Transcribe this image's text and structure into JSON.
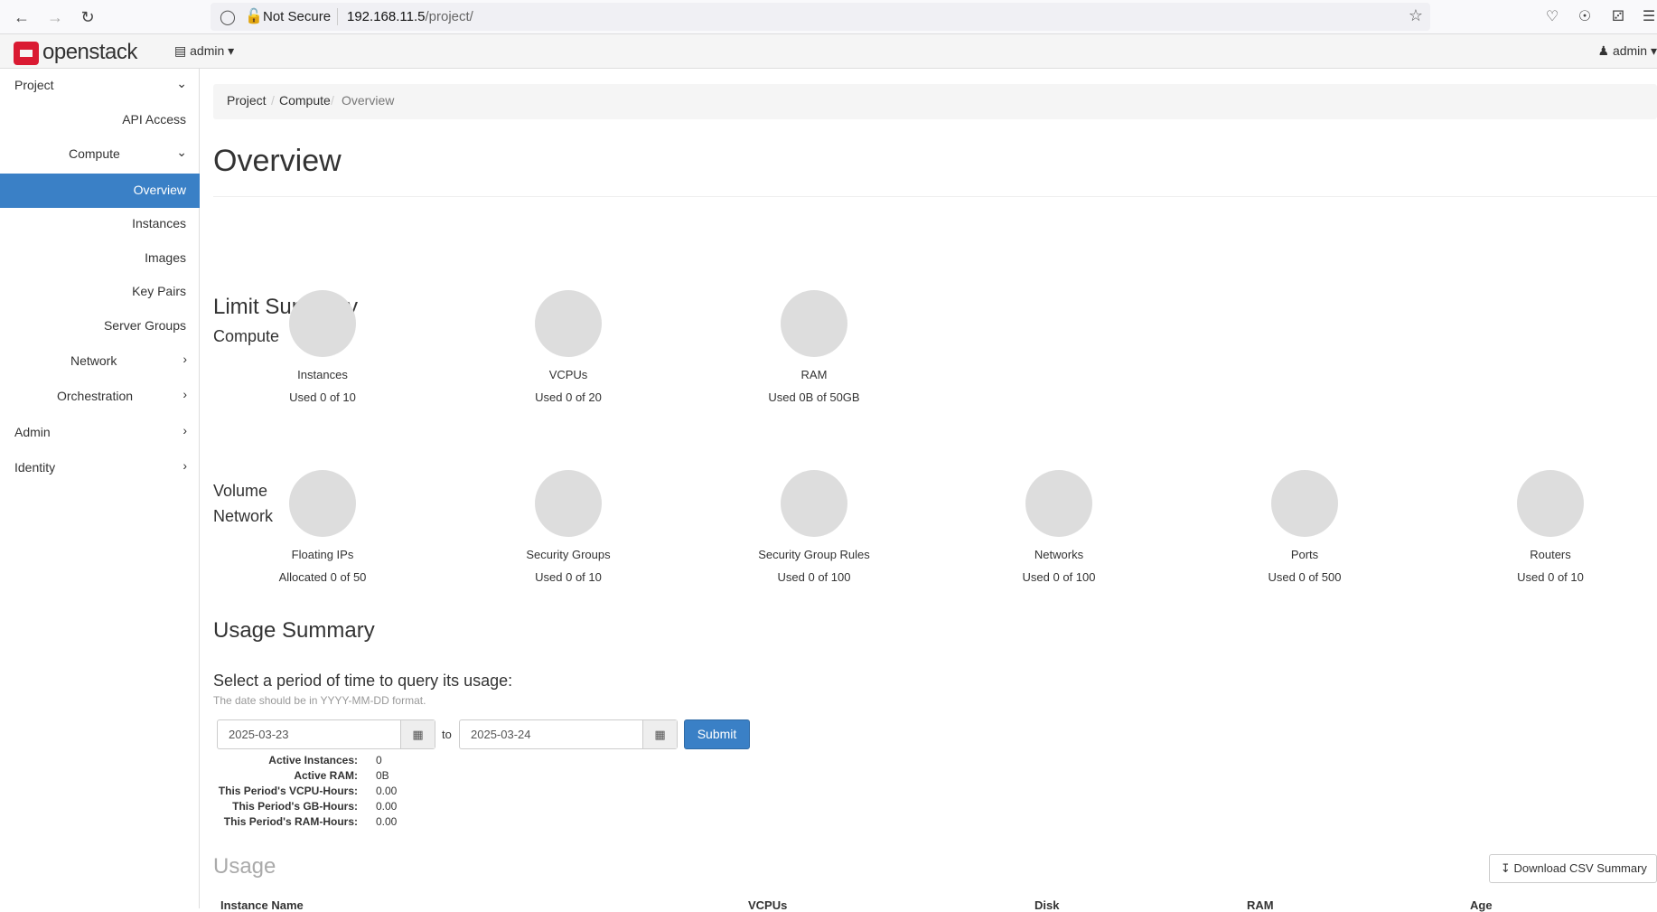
{
  "browser": {
    "security_text": "Not Secure",
    "url_host": "192.168.11.5",
    "url_path": "/project/"
  },
  "topnav": {
    "brand": "openstack",
    "project_selector": "admin",
    "user_menu": "admin"
  },
  "sidebar": {
    "items": [
      {
        "label": "Project"
      },
      {
        "label": "API Access"
      },
      {
        "label": "Compute"
      },
      {
        "label": "Overview"
      },
      {
        "label": "Instances"
      },
      {
        "label": "Images"
      },
      {
        "label": "Key Pairs"
      },
      {
        "label": "Server Groups"
      },
      {
        "label": "Network"
      },
      {
        "label": "Orchestration"
      },
      {
        "label": "Admin"
      },
      {
        "label": "Identity"
      }
    ]
  },
  "breadcrumb": [
    "Project",
    "Compute",
    "Overview"
  ],
  "page_title": "Overview",
  "limit_summary": {
    "title": "Limit Summary",
    "compute_title": "Compute",
    "compute": [
      {
        "name": "Instances",
        "usage": "Used 0 of 10"
      },
      {
        "name": "VCPUs",
        "usage": "Used 0 of 20"
      },
      {
        "name": "RAM",
        "usage": "Used 0B of 50GB"
      }
    ],
    "volume_title": "Volume",
    "network_title": "Network",
    "network": [
      {
        "name": "Floating IPs",
        "usage": "Allocated 0 of 50"
      },
      {
        "name": "Security Groups",
        "usage": "Used 0 of 10"
      },
      {
        "name": "Security Group Rules",
        "usage": "Used 0 of 100"
      },
      {
        "name": "Networks",
        "usage": "Used 0 of 100"
      },
      {
        "name": "Ports",
        "usage": "Used 0 of 500"
      },
      {
        "name": "Routers",
        "usage": "Used 0 of 10"
      }
    ]
  },
  "usage_summary": {
    "title": "Usage Summary",
    "query_label": "Select a period of time to query its usage:",
    "help": "The date should be in YYYY-MM-DD format.",
    "start_date": "2025-03-23",
    "to_label": "to",
    "end_date": "2025-03-24",
    "submit": "Submit",
    "stats": [
      {
        "key": "Active Instances:",
        "value": "0"
      },
      {
        "key": "Active RAM:",
        "value": "0B"
      },
      {
        "key": "This Period's VCPU-Hours:",
        "value": "0.00"
      },
      {
        "key": "This Period's GB-Hours:",
        "value": "0.00"
      },
      {
        "key": "This Period's RAM-Hours:",
        "value": "0.00"
      }
    ]
  },
  "usage": {
    "title": "Usage",
    "download_button": "Download CSV Summary",
    "columns": [
      "Instance Name",
      "VCPUs",
      "Disk",
      "RAM",
      "Age"
    ]
  }
}
